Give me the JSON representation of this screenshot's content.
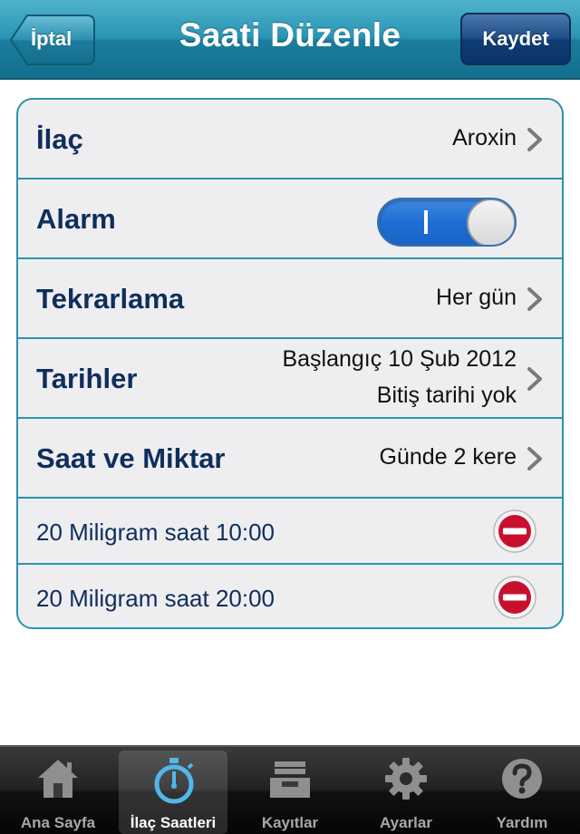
{
  "navbar": {
    "title": "Saati Düzenle",
    "back_label": "İptal",
    "save_label": "Kaydet"
  },
  "rows": {
    "drug": {
      "label": "İlaç",
      "value": "Aroxin"
    },
    "alarm": {
      "label": "Alarm",
      "state": "on"
    },
    "repeat": {
      "label": "Tekrarlama",
      "value": "Her gün"
    },
    "dates": {
      "label": "Tarihler",
      "start": "Başlangıç 10 Şub 2012",
      "end": "Bitiş tarihi yok"
    },
    "time_amount": {
      "label": "Saat ve Miktar",
      "value": "Günde 2 kere"
    }
  },
  "doses": [
    {
      "text": "20 Miligram saat 10:00"
    },
    {
      "text": "20 Miligram saat 20:00"
    }
  ],
  "tabs": [
    {
      "label": "Ana Sayfa",
      "icon": "home-icon"
    },
    {
      "label": "İlaç Saatleri",
      "icon": "stopwatch-icon",
      "active": true
    },
    {
      "label": "Kayıtlar",
      "icon": "tray-icon"
    },
    {
      "label": "Ayarlar",
      "icon": "gear-icon"
    },
    {
      "label": "Yardım",
      "icon": "help-icon"
    }
  ],
  "colors": {
    "navbar": "#2a95b3",
    "border": "#2c93ad",
    "label_text": "#0f2e5c",
    "delete": "#c8102e",
    "toggle_on": "#1f6fd4"
  }
}
